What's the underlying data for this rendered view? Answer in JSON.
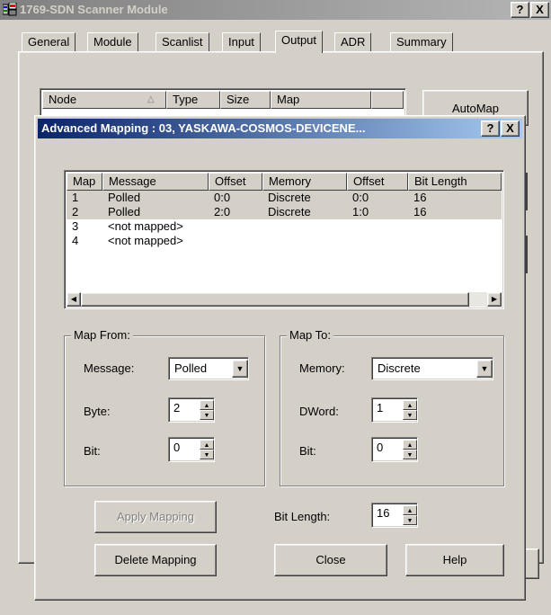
{
  "main_window": {
    "title": "1769-SDN Scanner Module",
    "help_btn": "?",
    "close_btn": "X",
    "tabs": [
      "General",
      "Module",
      "Scanlist",
      "Input",
      "Output",
      "ADR",
      "Summary"
    ],
    "active_tab": "Output",
    "list_headers": [
      "Node",
      "Type",
      "Size",
      "Map"
    ],
    "automap_label": "AutoMap"
  },
  "dialog": {
    "title": "Advanced Mapping : 03, YASKAWA-COSMOS-DEVICENE...",
    "help_btn": "?",
    "close_btn": "X",
    "mapping_list": {
      "headers": [
        "Map",
        "Message",
        "Offset",
        "Memory",
        "Offset",
        "Bit Length"
      ],
      "rows": [
        [
          "1",
          "Polled",
          "0:0",
          "Discrete",
          "0:0",
          "16"
        ],
        [
          "2",
          "Polled",
          "2:0",
          "Discrete",
          "1:0",
          "16"
        ],
        [
          "3",
          "<not mapped>",
          "",
          "",
          "",
          ""
        ],
        [
          "4",
          "<not mapped>",
          "",
          "",
          "",
          ""
        ]
      ]
    },
    "map_from": {
      "legend": "Map From:",
      "message_label": "Message:",
      "message_value": "Polled",
      "byte_label": "Byte:",
      "byte_value": "2",
      "bit_label": "Bit:",
      "bit_value": "0"
    },
    "map_to": {
      "legend": "Map To:",
      "memory_label": "Memory:",
      "memory_value": "Discrete",
      "dword_label": "DWord:",
      "dword_value": "1",
      "bit_label": "Bit:",
      "bit_value": "0"
    },
    "bit_length_label": "Bit Length:",
    "bit_length_value": "16",
    "apply_mapping": "Apply Mapping",
    "delete_mapping": "Delete Mapping",
    "close": "Close",
    "help": "Help"
  }
}
